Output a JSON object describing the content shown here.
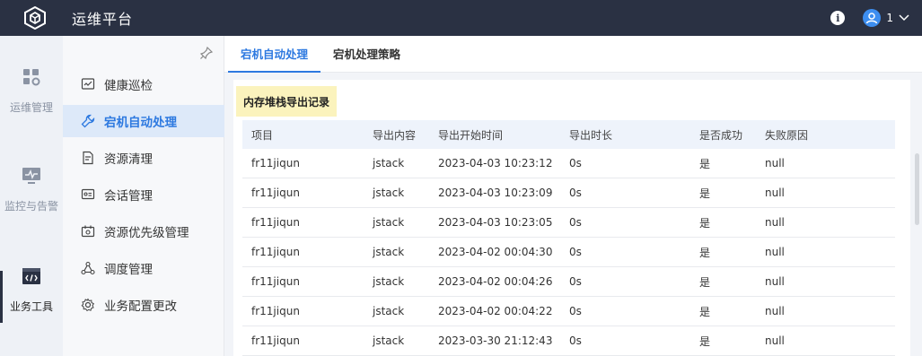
{
  "app": {
    "title": "运维平台",
    "user_count": "1"
  },
  "rail": [
    {
      "label": "运维管理",
      "icon": "grid-gear-icon"
    },
    {
      "label": "监控与告警",
      "icon": "monitor-icon"
    },
    {
      "label": "业务工具",
      "icon": "code-window-icon"
    }
  ],
  "menu": [
    {
      "label": "健康巡检",
      "icon": "chart-monitor-icon"
    },
    {
      "label": "宕机自动处理",
      "icon": "wrench-icon"
    },
    {
      "label": "资源清理",
      "icon": "doc-clean-icon"
    },
    {
      "label": "会话管理",
      "icon": "session-icon"
    },
    {
      "label": "资源优先级管理",
      "icon": "priority-icon"
    },
    {
      "label": "调度管理",
      "icon": "schedule-nodes-icon"
    },
    {
      "label": "业务配置更改",
      "icon": "config-gear-icon"
    }
  ],
  "tabs": [
    {
      "label": "宕机自动处理"
    },
    {
      "label": "宕机处理策略"
    }
  ],
  "section": {
    "title": "内存堆栈导出记录"
  },
  "table": {
    "headers": [
      "项目",
      "导出内容",
      "导出开始时间",
      "导出时长",
      "是否成功",
      "失败原因"
    ],
    "rows": [
      [
        "fr11jiqun",
        "jstack",
        "2023-04-03 10:23:12",
        "0s",
        "是",
        "null"
      ],
      [
        "fr11jiqun",
        "jstack",
        "2023-04-03 10:23:09",
        "0s",
        "是",
        "null"
      ],
      [
        "fr11jiqun",
        "jstack",
        "2023-04-03 10:23:05",
        "0s",
        "是",
        "null"
      ],
      [
        "fr11jiqun",
        "jstack",
        "2023-04-02 00:04:30",
        "0s",
        "是",
        "null"
      ],
      [
        "fr11jiqun",
        "jstack",
        "2023-04-02 00:04:26",
        "0s",
        "是",
        "null"
      ],
      [
        "fr11jiqun",
        "jstack",
        "2023-04-02 00:04:22",
        "0s",
        "是",
        "null"
      ],
      [
        "fr11jiqun",
        "jstack",
        "2023-03-30 21:12:43",
        "0s",
        "是",
        "null"
      ]
    ]
  },
  "colors": {
    "topbar": "#2a3143",
    "accent": "#2d79e0",
    "tag_bg": "#fbf3bd"
  }
}
